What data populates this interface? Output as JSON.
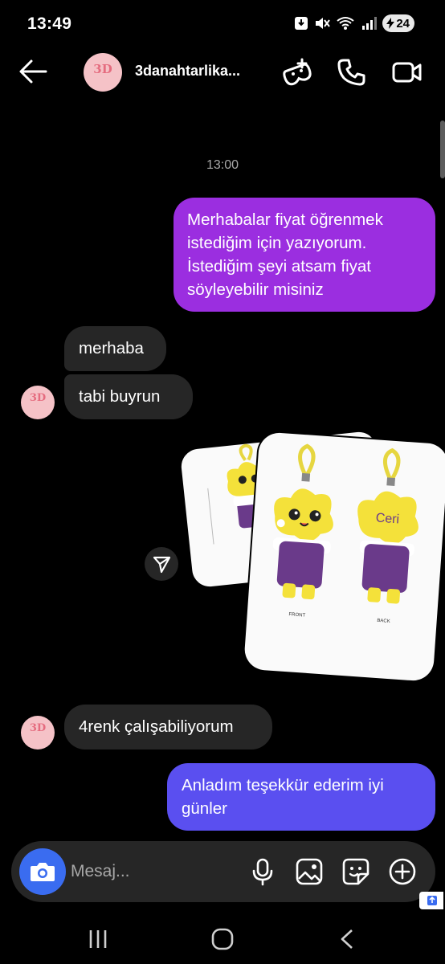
{
  "status_bar": {
    "time": "13:49",
    "battery": "24"
  },
  "header": {
    "contact_name": "3danahtarlika...",
    "avatar_text": "3D"
  },
  "conversation": {
    "timestamp": "13:00",
    "messages": [
      {
        "from": "me",
        "text": "Merhabalar fiyat öğrenmek istediğim için yazıyorum. İstediğim şeyi atsam fiyat söyleyebilir misiniz"
      },
      {
        "from": "them",
        "text": "merhaba"
      },
      {
        "from": "them",
        "text": "tabi buyrun"
      },
      {
        "from": "them",
        "text": "4renk çalışabiliyorum"
      },
      {
        "from": "me",
        "text": "Anladım teşekkür ederim iyi günler"
      }
    ],
    "photo_front_labels": {
      "text": "Ceri",
      "front": "FRONT",
      "back": "BACK"
    }
  },
  "composer": {
    "placeholder": "Mesaj..."
  },
  "colors": {
    "outgoing_1": "#9b2ee0",
    "outgoing_2": "#5a4ff0",
    "incoming": "#262626",
    "camera": "#3a6cf0"
  }
}
